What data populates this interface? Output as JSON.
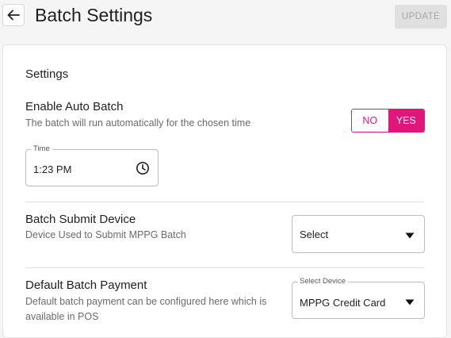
{
  "header": {
    "title": "Batch Settings",
    "update_label": "UPDATE"
  },
  "settings": {
    "section_title": "Settings",
    "auto_batch": {
      "title": "Enable Auto Batch",
      "description": "The batch will run automatically for the chosen time",
      "toggle_no": "NO",
      "toggle_yes": "YES",
      "selected": "YES"
    },
    "time": {
      "label": "Time",
      "value": "1:23 PM"
    },
    "submit_device": {
      "title": "Batch Submit Device",
      "description": "Device Used to Submit MPPG Batch",
      "value": "Select"
    },
    "default_payment": {
      "title": "Default Batch Payment",
      "description_line1": "Default batch payment can be configured here which is",
      "description_line2": "available in POS",
      "label": "Select Device",
      "value": "MPPG Credit Card"
    }
  },
  "colors": {
    "accent": "#e0177a",
    "disabled_button_bg": "#e0e0e0",
    "disabled_button_text": "#a6a6a6",
    "page_bg": "#f5f5f5"
  },
  "icons": {
    "back": "arrow-left-icon",
    "time": "clock-icon",
    "dropdown": "caret-down-icon"
  }
}
